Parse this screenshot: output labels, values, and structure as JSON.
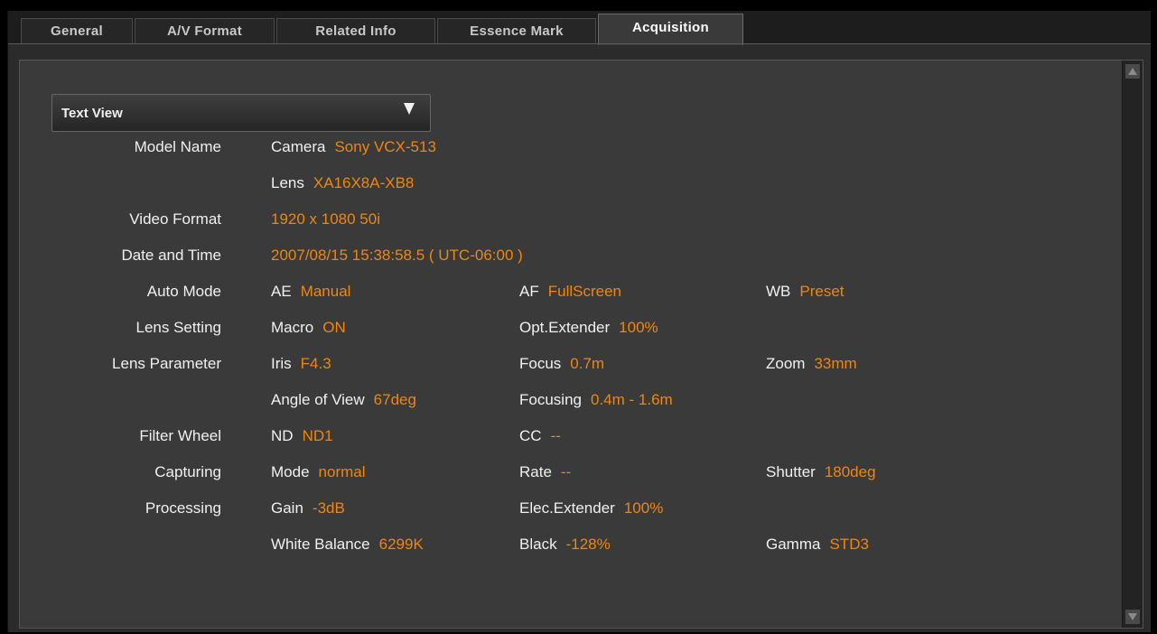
{
  "tabs": [
    {
      "label": "General"
    },
    {
      "label": "A/V Format"
    },
    {
      "label": "Related Info"
    },
    {
      "label": "Essence Mark"
    },
    {
      "label": "Acquisition",
      "active": true
    }
  ],
  "view_select": {
    "selected": "Text View"
  },
  "colors": {
    "value": "#f0860c",
    "label": "#f0f0f0",
    "background": "#3a3a3a"
  },
  "rows": {
    "model_name": {
      "label": "Model Name",
      "camera_key": "Camera",
      "camera_val": "Sony VCX-513",
      "lens_key": "Lens",
      "lens_val": "XA16X8A-XB8"
    },
    "video_format": {
      "label": "Video Format",
      "value": "1920 x 1080  50i"
    },
    "date_time": {
      "label": "Date and Time",
      "value": "2007/08/15 15:38:58.5 ( UTC-06:00 )"
    },
    "auto_mode": {
      "label": "Auto Mode",
      "ae_key": "AE",
      "ae_val": "Manual",
      "af_key": "AF",
      "af_val": "FullScreen",
      "wb_key": "WB",
      "wb_val": "Preset"
    },
    "lens_setting": {
      "label": "Lens Setting",
      "macro_key": "Macro",
      "macro_val": "ON",
      "optext_key": "Opt.Extender",
      "optext_val": "100%"
    },
    "lens_parameter": {
      "label": "Lens Parameter",
      "iris_key": "Iris",
      "iris_val": "F4.3",
      "focus_key": "Focus",
      "focus_val": "0.7m",
      "zoom_key": "Zoom",
      "zoom_val": "33mm",
      "aov_key": "Angle of View",
      "aov_val": "67deg",
      "focusing_key": "Focusing",
      "focusing_val": "0.4m - 1.6m"
    },
    "filter_wheel": {
      "label": "Filter Wheel",
      "nd_key": "ND",
      "nd_val": "ND1",
      "cc_key": "CC",
      "cc_val": "--"
    },
    "capturing": {
      "label": "Capturing",
      "mode_key": "Mode",
      "mode_val": "normal",
      "rate_key": "Rate",
      "rate_val": "--",
      "shutter_key": "Shutter",
      "shutter_val": "180deg"
    },
    "processing": {
      "label": "Processing",
      "gain_key": "Gain",
      "gain_val": "-3dB",
      "elecext_key": "Elec.Extender",
      "elecext_val": "100%",
      "wbal_key": "White Balance",
      "wbal_val": "6299K",
      "black_key": "Black",
      "black_val": "-128%",
      "gamma_key": "Gamma",
      "gamma_val": "STD3"
    }
  }
}
